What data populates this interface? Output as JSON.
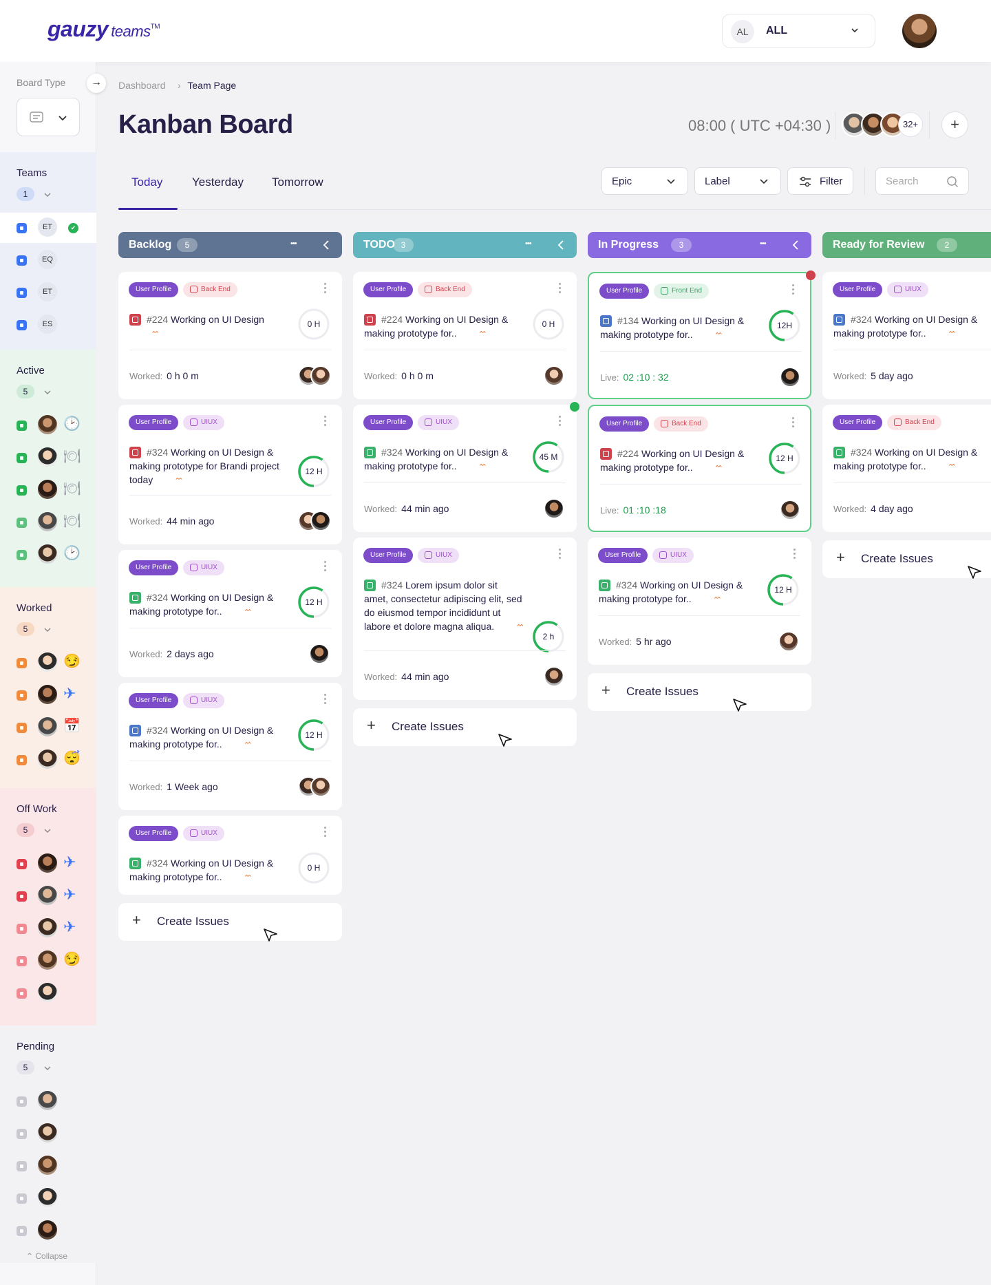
{
  "header": {
    "logo_main": "gauzy",
    "logo_sub": "teams",
    "logo_tm": "TM",
    "team_select": {
      "initials": "AL",
      "label": "ALL"
    }
  },
  "sidebar": {
    "board_type_label": "Board Type",
    "groups": [
      {
        "label": "Teams",
        "count": "1",
        "bg": "#eceef8",
        "chk": "#3b74f2",
        "members": [
          {
            "initials": "ET",
            "status": "check-circle-icon"
          },
          {
            "initials": "EQ"
          },
          {
            "initials": "ET"
          },
          {
            "initials": "ES"
          }
        ]
      },
      {
        "label": "Active",
        "count": "5",
        "bg": "#eaf5ee",
        "chk": "#27b356",
        "members": [
          {
            "status": "clock-icon"
          },
          {
            "status": "dish-icon"
          },
          {
            "status": "dish-icon"
          },
          {
            "status": "dish-icon"
          },
          {
            "status": "clock-icon"
          }
        ]
      },
      {
        "label": "Worked",
        "count": "5",
        "bg": "#fbeee6",
        "chk": "#f08a3c",
        "members": [
          {
            "status": "smirk-emoji"
          },
          {
            "status": "airplane-icon"
          },
          {
            "status": "calendar-icon"
          },
          {
            "status": "sleepy-emoji"
          }
        ]
      },
      {
        "label": "Off Work",
        "count": "5",
        "bg": "#fbe6e8",
        "chk": "#e0414f",
        "members": [
          {
            "status": "airplane-icon"
          },
          {
            "status": "airplane-icon"
          },
          {
            "status": "airplane-icon"
          },
          {
            "status": "smirk-emoji"
          },
          {}
        ]
      },
      {
        "label": "Pending",
        "count": "5",
        "bg": "#f2f2f5",
        "chk": "#c9c9d2",
        "members": [
          {},
          {},
          {},
          {},
          {}
        ]
      }
    ],
    "collapse_label": "Collapse"
  },
  "breadcrumb": {
    "root": "Dashboard",
    "current": "Team Page"
  },
  "page": {
    "title": "Kanban Board",
    "time": "08:00 ( UTC +04:30 )",
    "members_more": "32+"
  },
  "tabs": [
    "Today",
    "Yesterday",
    "Tomorrow"
  ],
  "controls": {
    "epic": "Epic",
    "label": "Label",
    "filter": "Filter",
    "search_placeholder": "Search"
  },
  "columns": [
    {
      "name": "Backlog",
      "count": "5",
      "color": "#5f7392",
      "cards": [
        {
          "tag2": "Back End",
          "tag2_type": "be",
          "icon": "#d0424b",
          "num": "#224",
          "title": "Working on UI Design",
          "ring": "0 H",
          "progress": 0,
          "worked_label": "Worked:",
          "worked": "0 h 0 m",
          "avs": 2
        },
        {
          "tag2": "UIUX",
          "tag2_type": "ui",
          "icon": "#d0424b",
          "num": "#324",
          "title": "Working on UI Design & making prototype for Brandi project today",
          "ring": "12 H",
          "progress": 0.6,
          "worked_label": "Worked:",
          "worked": "44 min ago",
          "avs": 2
        },
        {
          "tag2": "UIUX",
          "tag2_type": "ui",
          "icon": "#38b26a",
          "num": "#324",
          "title": "Working on UI Design & making prototype for..",
          "ring": "12 H",
          "progress": 0.6,
          "worked_label": "Worked:",
          "worked": "2 days ago",
          "avs": 1
        },
        {
          "tag2": "UIUX",
          "tag2_type": "ui",
          "icon": "#4b77c9",
          "num": "#324",
          "title": "Working on UI Design & making prototype for..",
          "ring": "12 H",
          "progress": 0.6,
          "worked_label": "Worked:",
          "worked": "1 Week ago",
          "avs": 2
        },
        {
          "tag2": "UIUX",
          "tag2_type": "ui",
          "icon": "#38b26a",
          "num": "#324",
          "title": "Working on UI Design & making prototype for..",
          "ring": "0 H",
          "progress": 0,
          "worked_label": "",
          "worked": "",
          "avs": 0
        }
      ]
    },
    {
      "name": "TODO",
      "count": "3",
      "color": "#62b5be",
      "cards": [
        {
          "tag2": "Back End",
          "tag2_type": "be",
          "icon": "#d0424b",
          "num": "#224",
          "title": "Working on UI Design & making prototype for..",
          "ring": "0 H",
          "progress": 0,
          "worked_label": "Worked:",
          "worked": "0 h 0 m",
          "avs": 1
        },
        {
          "tag2": "UIUX",
          "tag2_type": "ui",
          "icon": "#38b26a",
          "num": "#324",
          "title": "Working on UI Design & making prototype for..",
          "ring": "45 M",
          "progress": 0.6,
          "worked_label": "Worked:",
          "worked": "44 min ago",
          "avs": 1,
          "dot": "green"
        },
        {
          "tag2": "UIUX",
          "tag2_type": "ui",
          "icon": "#38b26a",
          "num": "#324",
          "title": "Lorem ipsum dolor sit amet, consectetur adipiscing elit, sed do eiusmod tempor incididunt ut labore et dolore magna aliqua.",
          "ring": "2 h",
          "progress": 0.6,
          "worked_label": "Worked:",
          "worked": "44 min ago",
          "avs": 1
        }
      ]
    },
    {
      "name": "In Progress",
      "count": "3",
      "color": "#8a6ae0",
      "cards": [
        {
          "tag2": "Front End",
          "tag2_type": "fe",
          "icon": "#4b77c9",
          "num": "#134",
          "title": "Working on UI Design & making prototype for..",
          "ring": "12H",
          "progress": 0.6,
          "worked_label": "Live:",
          "worked": "02 :10 : 32",
          "live": true,
          "avs": 1,
          "dot": "red"
        },
        {
          "tag2": "Back End",
          "tag2_type": "be",
          "icon": "#d0424b",
          "num": "#224",
          "title": "Working on UI Design & making prototype for..",
          "ring": "12 H",
          "progress": 0.6,
          "worked_label": "Live:",
          "worked": "01 :10 :18",
          "live": true,
          "avs": 1
        },
        {
          "tag2": "UIUX",
          "tag2_type": "ui",
          "icon": "#38b26a",
          "num": "#324",
          "title": "Working on UI Design & making prototype for..",
          "ring": "12 H",
          "progress": 0.6,
          "worked_label": "Worked:",
          "worked": "5 hr ago",
          "avs": 1
        }
      ]
    },
    {
      "name": "Ready for Review",
      "count": "2",
      "color": "#5fb07a",
      "cards": [
        {
          "tag2": "UIUX",
          "tag2_type": "ui",
          "icon": "#4b77c9",
          "num": "#324",
          "title": "Working on UI Design & making prototype for..",
          "ring": "",
          "progress": 0,
          "worked_label": "Worked:",
          "worked": "5 day ago",
          "avs": 0
        },
        {
          "tag2": "Back End",
          "tag2_type": "be",
          "icon": "#38b26a",
          "num": "#324",
          "title": "Working on UI Design & making prototype for..",
          "ring": "",
          "progress": 0,
          "worked_label": "Worked:",
          "worked": "4 day ago",
          "avs": 0
        }
      ]
    }
  ],
  "card_tag1": "User Profile",
  "create_issues": "Create Issues"
}
